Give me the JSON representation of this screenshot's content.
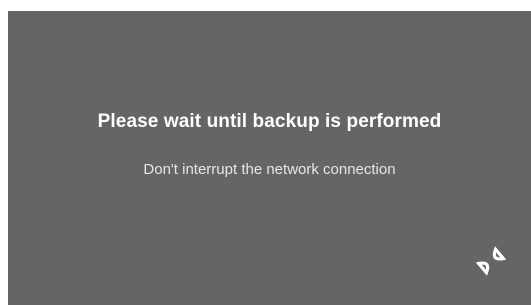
{
  "dialog": {
    "title": "Please wait until backup is performed",
    "subtitle": "Don't interrupt the network connection"
  },
  "logo": {
    "icon": "brand-logo-icon"
  },
  "colors": {
    "background": "#656565",
    "title_text": "#ffffff",
    "subtitle_text": "#e6e6e6"
  }
}
